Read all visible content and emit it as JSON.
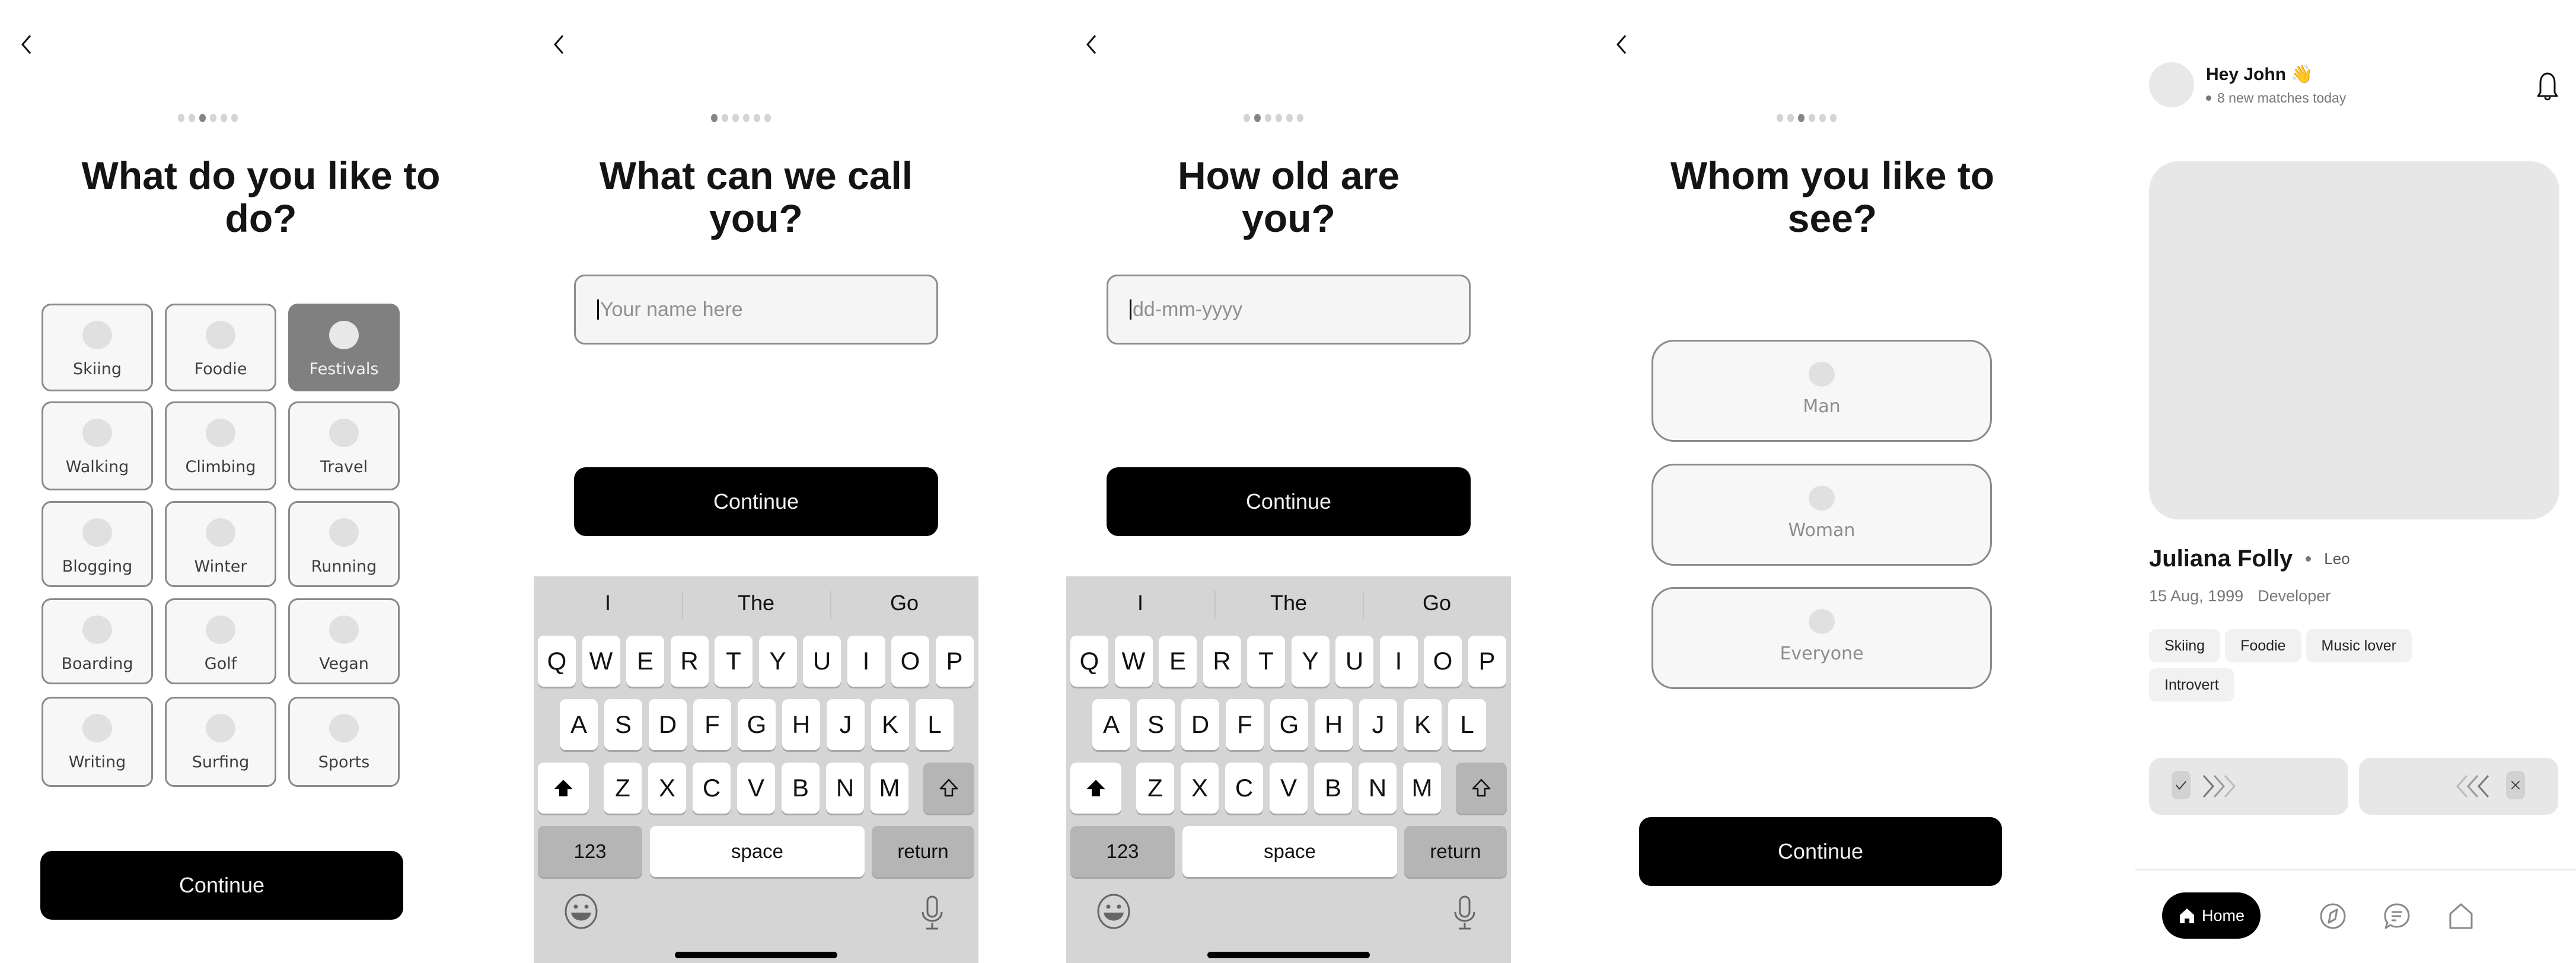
{
  "common": {
    "continue_label": "Continue",
    "progress_total_steps": 6
  },
  "screen_activities": {
    "progress_step": 3,
    "title": "What do you like to do?",
    "activities": [
      {
        "label": "Skiing",
        "selected": false
      },
      {
        "label": "Foodie",
        "selected": false
      },
      {
        "label": "Festivals",
        "selected": true
      },
      {
        "label": "Walking",
        "selected": false
      },
      {
        "label": "Climbing",
        "selected": false
      },
      {
        "label": "Travel",
        "selected": false
      },
      {
        "label": "Blogging",
        "selected": false
      },
      {
        "label": "Winter",
        "selected": false
      },
      {
        "label": "Running",
        "selected": false
      },
      {
        "label": "Boarding",
        "selected": false
      },
      {
        "label": "Golf",
        "selected": false
      },
      {
        "label": "Vegan",
        "selected": false
      },
      {
        "label": "Writing",
        "selected": false
      },
      {
        "label": "Surfing",
        "selected": false
      },
      {
        "label": "Sports",
        "selected": false
      }
    ]
  },
  "screen_name": {
    "progress_step": 1,
    "title": "What can we call you?",
    "input_value": "",
    "input_placeholder": "Your name here"
  },
  "screen_age": {
    "progress_step": 2,
    "title": "How old are you?",
    "input_value": "",
    "input_placeholder": "dd-mm-yyyy"
  },
  "screen_preference": {
    "progress_step": 3,
    "title": "Whom you like to see?",
    "options": [
      "Man",
      "Woman",
      "Everyone"
    ]
  },
  "keyboard": {
    "suggestions": [
      "I",
      "The",
      "Go"
    ],
    "row1": [
      "Q",
      "W",
      "E",
      "R",
      "T",
      "Y",
      "U",
      "I",
      "O",
      "P"
    ],
    "row2": [
      "A",
      "S",
      "D",
      "F",
      "G",
      "H",
      "J",
      "K",
      "L"
    ],
    "row3": [
      "Z",
      "X",
      "C",
      "V",
      "B",
      "N",
      "M"
    ],
    "numbers_label": "123",
    "space_label": "space",
    "return_label": "return"
  },
  "home": {
    "greeting": "Hey John 👋",
    "subtitle": "8 new matches today",
    "profile": {
      "name": "Juliana Folly",
      "sign": "Leo",
      "birthdate": "15 Aug, 1999",
      "occupation": "Developer",
      "tags": [
        "Skiing",
        "Foodie",
        "Music lover",
        "Introvert"
      ]
    },
    "nav": {
      "home_label": "Home",
      "items": [
        "home",
        "explore",
        "messages",
        "profile"
      ]
    }
  }
}
